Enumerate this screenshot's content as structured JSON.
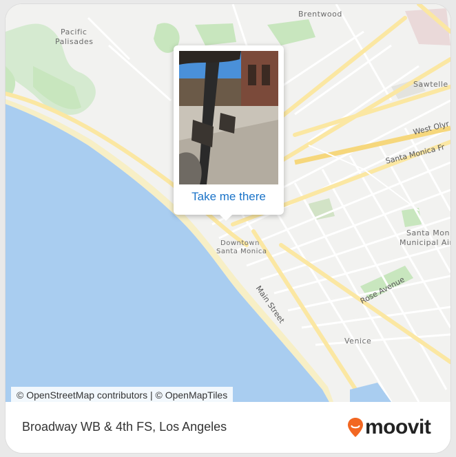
{
  "map": {
    "labels": {
      "brentwood": "Brentwood",
      "pacific_palisades_1": "Pacific",
      "pacific_palisades_2": "Palisades",
      "sawtelle": "Sawtelle",
      "downtown_1": "Downtown",
      "downtown_2": "Santa Monica",
      "venice": "Venice",
      "smma_1": "Santa Moni",
      "smma_2": "Municipal Air"
    },
    "streets": {
      "west_olympic": "West Olyr",
      "santa_monica_fwy": "Santa Monica Fr",
      "main_street": "Main Street",
      "rose_avenue": "Rose Avenue"
    },
    "colors": {
      "water": "#a9cdf0",
      "land": "#f2f2f0",
      "park": "#c8e6be",
      "major_road": "#fbe7a2",
      "road": "#ffffff"
    }
  },
  "attribution": "© OpenStreetMap contributors | © OpenMapTiles",
  "popup": {
    "action_label": "Take me there",
    "photo_icon": "street-photo"
  },
  "footer": {
    "title": "Broadway WB & 4th FS, Los Angeles",
    "logo_text": "moovit",
    "logo_icon": "location-pin-icon",
    "logo_color": "#f26722"
  }
}
